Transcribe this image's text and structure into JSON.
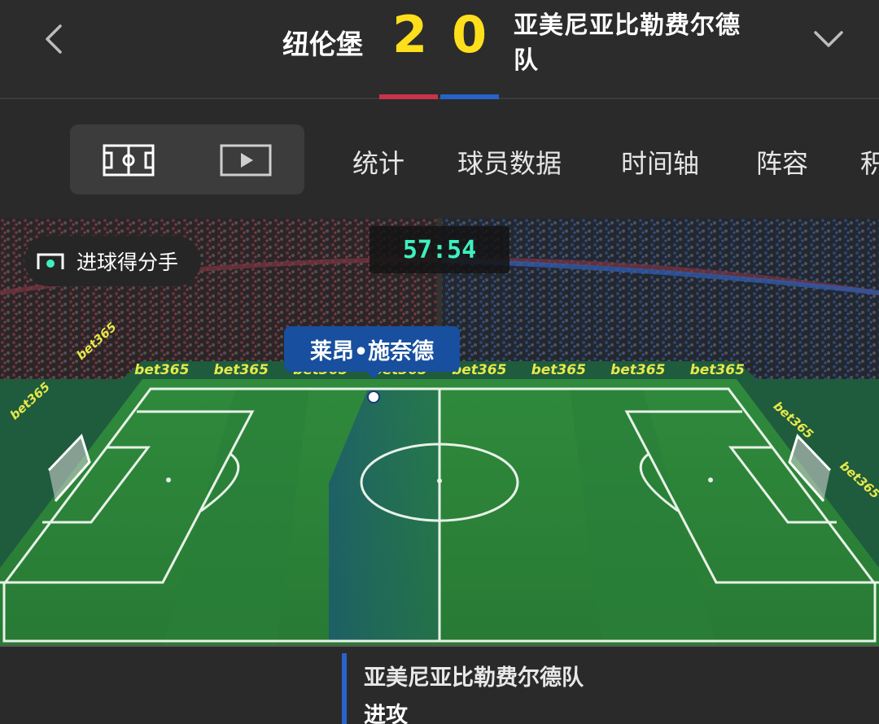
{
  "match": {
    "home_team": "纽伦堡",
    "home_score": "2",
    "away_score": "0",
    "away_team": "亚美尼亚比勒费尔德队",
    "home_color": "#c8344b",
    "away_color": "#2563c9",
    "score_color": "#ffdf1b"
  },
  "nav": {
    "back_icon": "chevron-left-icon",
    "expand_icon": "chevron-down-icon"
  },
  "tabs": {
    "view_toggle": {
      "pitch_icon": "pitch-icon",
      "video_icon": "play-video-icon"
    },
    "items": [
      {
        "label": "统计"
      },
      {
        "label": "球员数据"
      },
      {
        "label": "时间轴"
      },
      {
        "label": "阵容"
      },
      {
        "label": "积"
      }
    ]
  },
  "pitch": {
    "scorer_button": "进球得分手",
    "clock": "57:54",
    "player_name": "莱昂•施奈德",
    "sponsor": "bet365",
    "clock_color": "#3ef0bf"
  },
  "status": {
    "team": "亚美尼亚比勒费尔德队",
    "action": "进攻",
    "accent": "#2a63c9"
  }
}
